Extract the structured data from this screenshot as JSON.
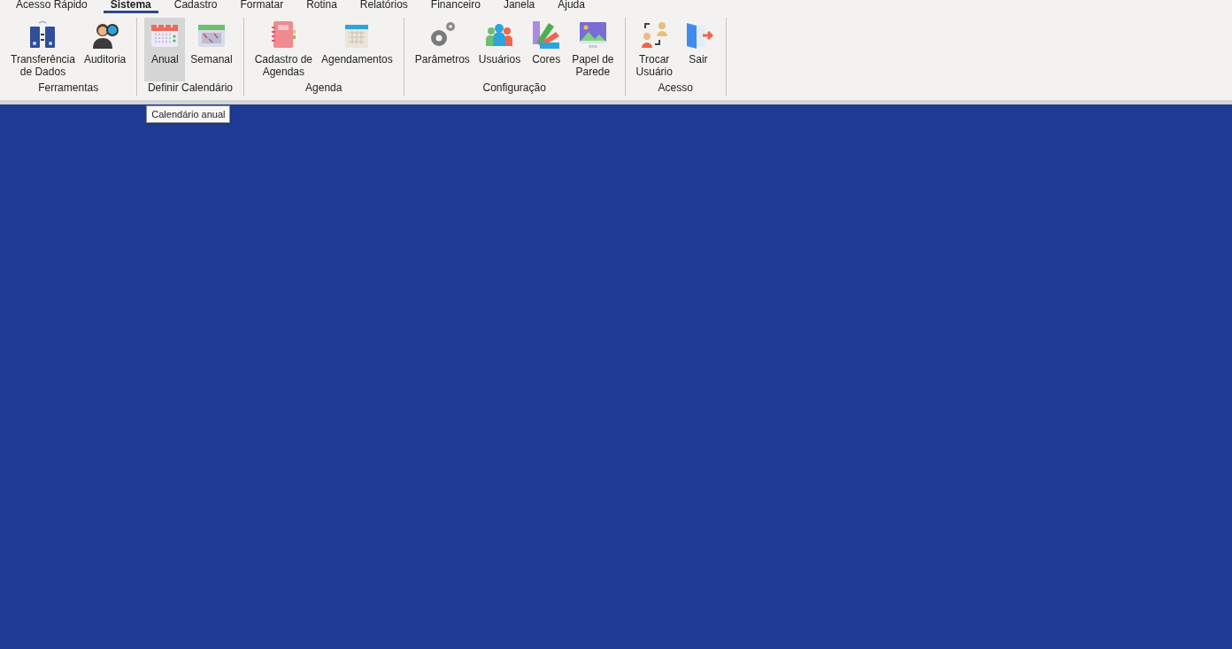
{
  "menu_tabs": [
    {
      "label": "Acesso Rápido",
      "selected": false
    },
    {
      "label": "Sistema",
      "selected": true
    },
    {
      "label": "Cadastro",
      "selected": false
    },
    {
      "label": "Formatar",
      "selected": false
    },
    {
      "label": "Rotina",
      "selected": false
    },
    {
      "label": "Relatórios",
      "selected": false
    },
    {
      "label": "Financeiro",
      "selected": false
    },
    {
      "label": "Janela",
      "selected": false
    },
    {
      "label": "Ajuda",
      "selected": false
    }
  ],
  "ribbon_groups": [
    {
      "label": "Ferramentas",
      "buttons": [
        {
          "label": "Transferência\nde Dados",
          "hovered": false
        },
        {
          "label": "Auditoria",
          "hovered": false
        }
      ]
    },
    {
      "label": "Definir Calendário",
      "buttons": [
        {
          "label": "Anual",
          "hovered": true
        },
        {
          "label": "Semanal",
          "hovered": false
        }
      ]
    },
    {
      "label": "Agenda",
      "buttons": [
        {
          "label": "Cadastro de\nAgendas",
          "hovered": false
        },
        {
          "label": "Agendamentos",
          "hovered": false
        }
      ]
    },
    {
      "label": "Configuração",
      "buttons": [
        {
          "label": "Parâmetros",
          "hovered": false
        },
        {
          "label": "Usuários",
          "hovered": false
        },
        {
          "label": "Cores",
          "hovered": false
        },
        {
          "label": "Papel de\nParede",
          "hovered": false
        }
      ]
    },
    {
      "label": "Acesso",
      "buttons": [
        {
          "label": "Trocar\nUsuário",
          "hovered": false
        },
        {
          "label": "Sair",
          "hovered": false
        }
      ]
    }
  ],
  "tooltip": "Calendário anual"
}
